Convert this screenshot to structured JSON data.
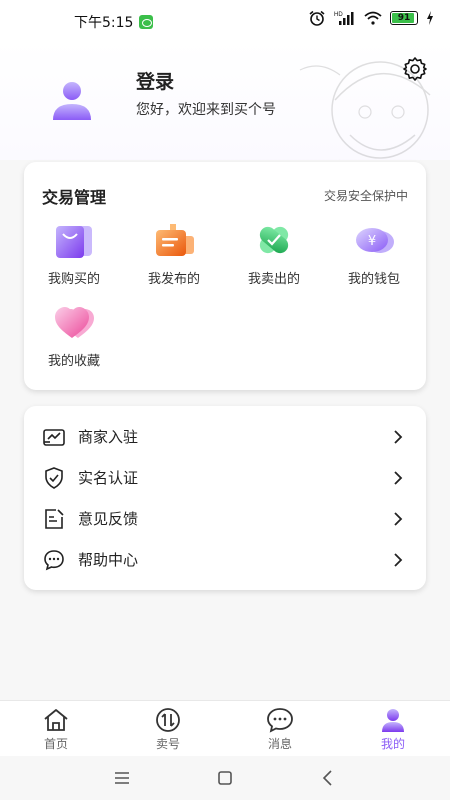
{
  "status_bar": {
    "time": "下午5:15",
    "network": "HD",
    "battery": "91",
    "battery_level": 0.91
  },
  "header": {
    "login_label": "登录",
    "welcome_text": "您好，欢迎来到买个号"
  },
  "trade": {
    "title": "交易管理",
    "secure_text": "交易安全保护中",
    "items": [
      {
        "label": "我购买的",
        "icon": "shopping-bag-icon"
      },
      {
        "label": "我发布的",
        "icon": "publish-box-icon"
      },
      {
        "label": "我卖出的",
        "icon": "sold-tag-icon"
      },
      {
        "label": "我的钱包",
        "icon": "wallet-icon"
      },
      {
        "label": "我的收藏",
        "icon": "heart-icon"
      }
    ]
  },
  "menu": {
    "items": [
      {
        "label": "商家入驻",
        "icon": "store-icon"
      },
      {
        "label": "实名认证",
        "icon": "shield-check-icon"
      },
      {
        "label": "意见反馈",
        "icon": "feedback-edit-icon"
      },
      {
        "label": "帮助中心",
        "icon": "help-chat-icon"
      }
    ]
  },
  "bottom_nav": {
    "items": [
      {
        "label": "首页",
        "icon": "home-icon",
        "active": false
      },
      {
        "label": "卖号",
        "icon": "swap-icon",
        "active": false
      },
      {
        "label": "消息",
        "icon": "message-icon",
        "active": false
      },
      {
        "label": "我的",
        "icon": "profile-icon",
        "active": true
      }
    ]
  },
  "colors": {
    "accent": "#8b5cf6",
    "wallet_purple": "#a78bfa",
    "heart_pink": "#f472b6",
    "box_orange": "#fb923c",
    "sold_green": "#4ade80"
  }
}
